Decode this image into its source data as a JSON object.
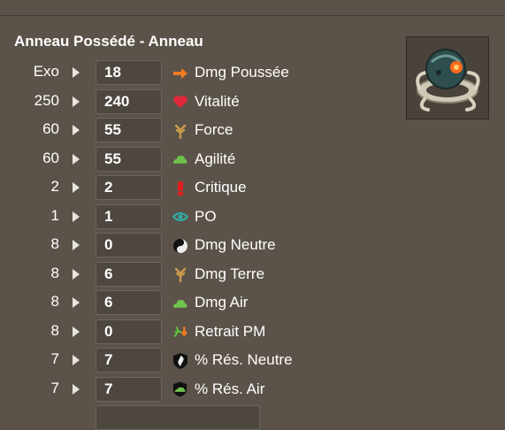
{
  "item": {
    "title": "Anneau Possédé - Anneau",
    "image_icon": "possessed-ring-icon"
  },
  "stats": [
    {
      "base": "Exo",
      "value": "18",
      "label": "Dmg Poussée",
      "icon": "push-damage-icon"
    },
    {
      "base": "250",
      "value": "240",
      "label": "Vitalité",
      "icon": "heart-icon"
    },
    {
      "base": "60",
      "value": "55",
      "label": "Force",
      "icon": "earth-icon"
    },
    {
      "base": "60",
      "value": "55",
      "label": "Agilité",
      "icon": "air-icon"
    },
    {
      "base": "2",
      "value": "2",
      "label": "Critique",
      "icon": "critical-icon"
    },
    {
      "base": "1",
      "value": "1",
      "label": "PO",
      "icon": "range-eye-icon"
    },
    {
      "base": "8",
      "value": "0",
      "label": "Dmg Neutre",
      "icon": "neutral-icon"
    },
    {
      "base": "8",
      "value": "6",
      "label": "Dmg Terre",
      "icon": "earth-icon"
    },
    {
      "base": "8",
      "value": "6",
      "label": "Dmg Air",
      "icon": "air-icon"
    },
    {
      "base": "8",
      "value": "0",
      "label": "Retrait PM",
      "icon": "mp-removal-icon"
    },
    {
      "base": "7",
      "value": "7",
      "label": "% Rés. Neutre",
      "icon": "neutral-resistance-icon"
    },
    {
      "base": "7",
      "value": "7",
      "label": "% Rés. Air",
      "icon": "air-resistance-icon"
    }
  ],
  "colors": {
    "background": "#5b534a",
    "input_bg": "#4e4740",
    "input_border": "#6e665d",
    "text": "#ffffff"
  }
}
